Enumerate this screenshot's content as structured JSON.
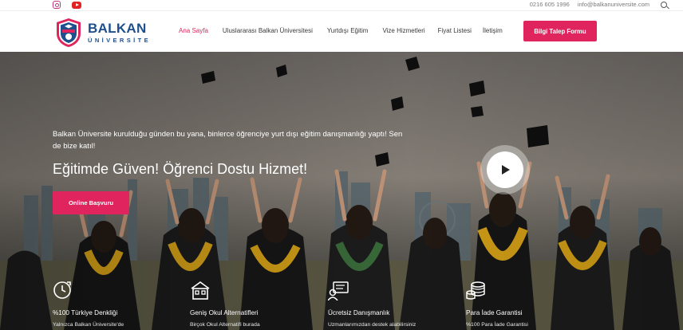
{
  "topbar": {
    "social": [
      {
        "icon": "instagram-icon"
      },
      {
        "icon": "youtube-icon"
      }
    ],
    "phone": "0216 605 1996",
    "email": "info@balkanuniversite.com",
    "search_icon": "search-icon"
  },
  "header": {
    "logo": {
      "line1": "BALKAN",
      "line2": "ÜNİVERSİTE"
    },
    "nav": [
      {
        "label": "Ana Sayfa",
        "active": true
      },
      {
        "label": "Uluslararası Balkan Üniversitesi",
        "active": false
      },
      {
        "label": "Yurtdışı Eğitim",
        "active": false
      },
      {
        "label": "Vize Hizmetleri",
        "active": false
      },
      {
        "label": "Fiyat Listesi",
        "active": false
      },
      {
        "label": "İletişim",
        "active": false
      }
    ],
    "cta_label": "Bilgi Talep Formu"
  },
  "hero": {
    "tagline": "Balkan Üniversite kurulduğu günden bu yana, binlerce öğrenciye yurt dışı eğitim danışmanlığı yaptı! Sen de bize katıl!",
    "headline": "Eğitimde Güven! Öğrenci Dostu Hizmet!",
    "apply_label": "Online Başvuru",
    "play_icon": "play-icon"
  },
  "features": [
    {
      "icon": "clock-check-icon",
      "title": "%100 Türkiye Denkliği",
      "desc": "Yalnızca Balkan Üniversite'de"
    },
    {
      "icon": "school-building-icon",
      "title": "Geniş Okul Alternatifleri",
      "desc": "Birçok Okul Alternatifi burada"
    },
    {
      "icon": "consulting-chat-icon",
      "title": "Ücretsiz Danışmanlık",
      "desc": "Uzmanlarımızdan destek alabilirsiniz"
    },
    {
      "icon": "coins-icon",
      "title": "Para İade Garantisi",
      "desc": "%100 Para İade Garantisi"
    }
  ],
  "colors": {
    "accent": "#e0245e",
    "brand_blue": "#1e4f8c"
  }
}
